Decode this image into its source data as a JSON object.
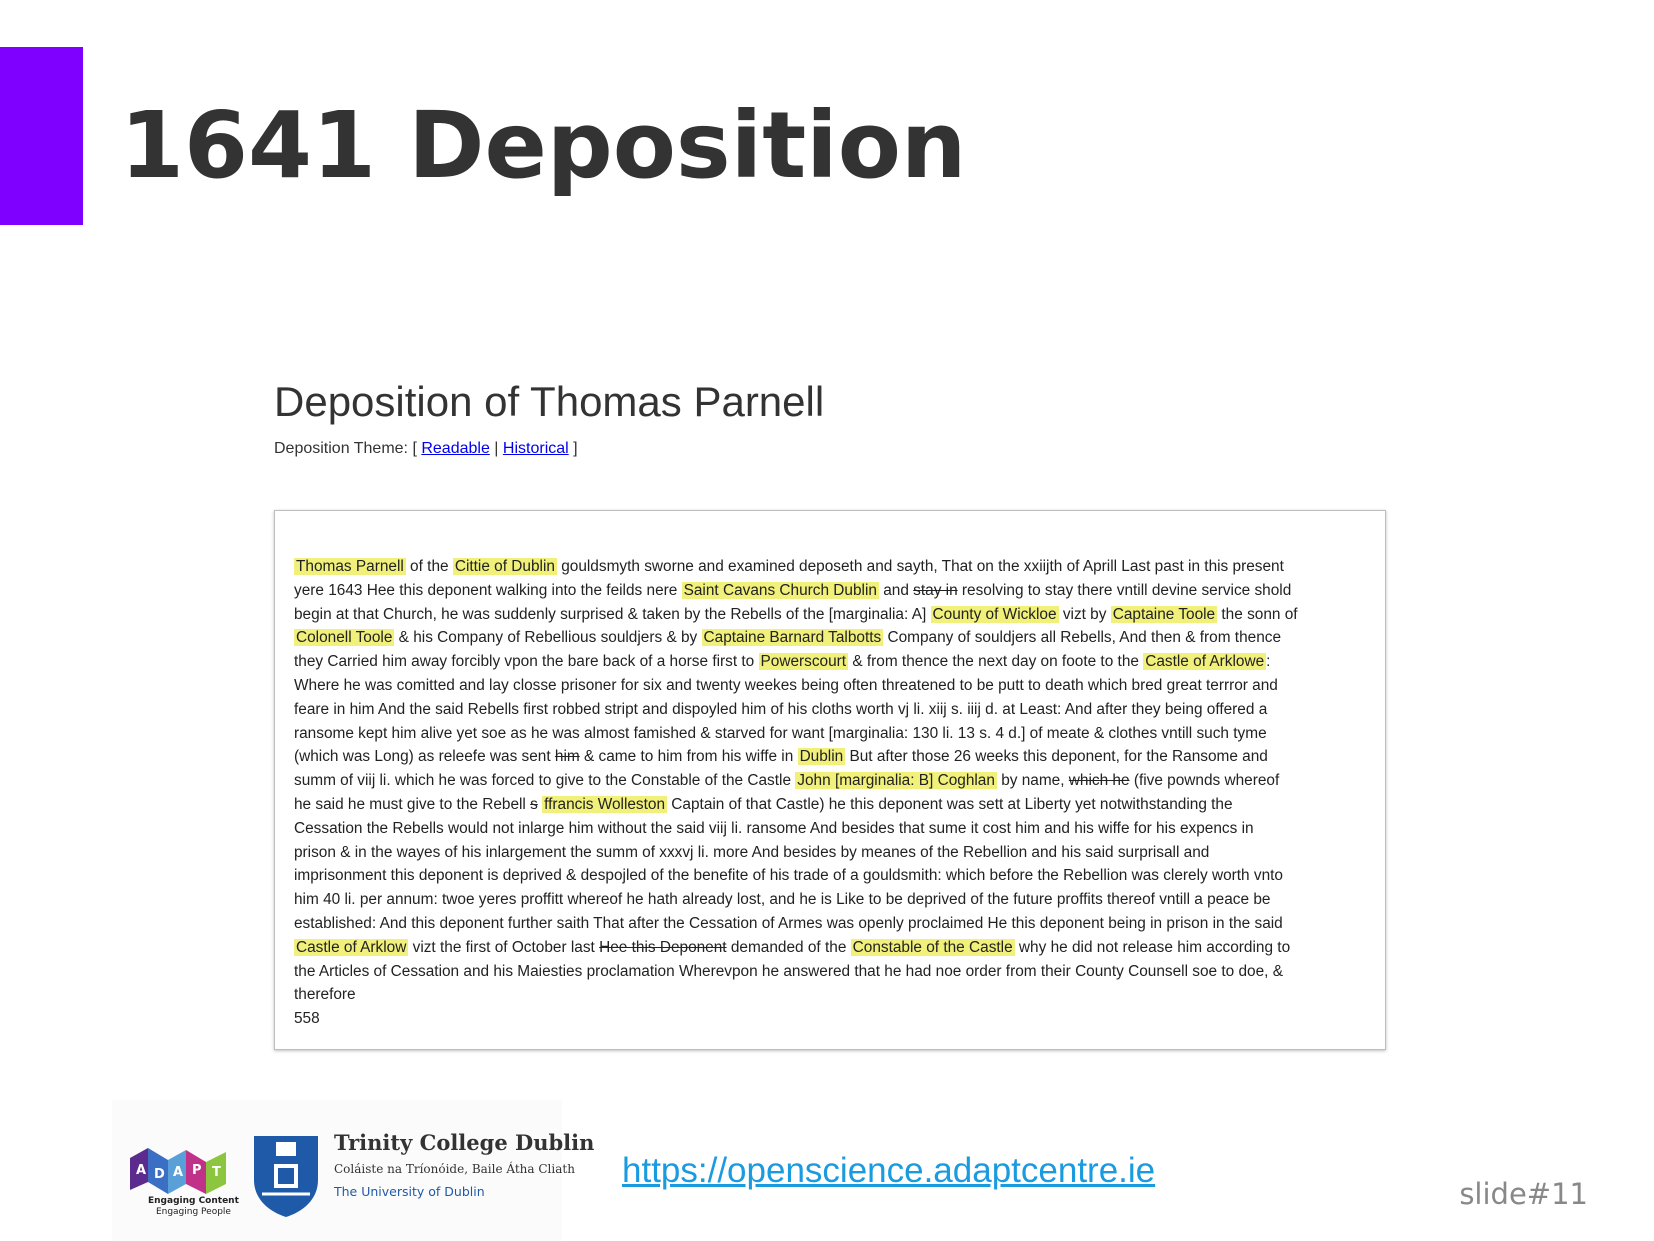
{
  "slide": {
    "title": "1641 Deposition",
    "link": "https://openscience.adaptcentre.ie",
    "slide_number": "slide#11",
    "accent_color": "#8000ff"
  },
  "deposition": {
    "heading": "Deposition of Thomas Parnell",
    "theme_label": "Deposition Theme: [",
    "theme_options": [
      "Readable",
      "Historical"
    ],
    "theme_separator": "|",
    "theme_close": "]",
    "highlight_color": "#f0f07a",
    "lines": [
      [
        {
          "t": "Thomas Parnell",
          "s": "hl"
        },
        {
          "t": " of the "
        },
        {
          "t": "Cittie of Dublin",
          "s": "hl"
        },
        {
          "t": " gouldsmyth sworne and examined deposeth and sayth, That on the xxiijth of Aprill Last past in this present"
        }
      ],
      [
        {
          "t": "yere 1643 Hee this deponent walking into the feilds nere "
        },
        {
          "t": "Saint Cavans Church Dublin",
          "s": "hl"
        },
        {
          "t": " and "
        },
        {
          "t": "stay in",
          "s": "del"
        },
        {
          "t": " resolving to stay there vntill devine service shold"
        }
      ],
      [
        {
          "t": "begin at that Church, he was suddenly surprised & taken by the Rebells of the [marginalia: A] "
        },
        {
          "t": "County of Wickloe",
          "s": "hl"
        },
        {
          "t": " vizt by "
        },
        {
          "t": "Captaine Toole",
          "s": "hl"
        },
        {
          "t": " the sonn of"
        }
      ],
      [
        {
          "t": "Colonell Toole",
          "s": "hl"
        },
        {
          "t": " & his Company of Rebellious souldjers & by "
        },
        {
          "t": "Captaine Barnard Talbotts",
          "s": "hl"
        },
        {
          "t": " Company of souldjers all Rebells, And then & from thence"
        }
      ],
      [
        {
          "t": "they Carried him away forcibly vpon the bare back of a horse first to "
        },
        {
          "t": "Powerscourt",
          "s": "hl"
        },
        {
          "t": " & from thence the next day on foote to the "
        },
        {
          "t": "Castle of Arklowe",
          "s": "hl"
        },
        {
          "t": ":"
        }
      ],
      [
        {
          "t": "Where he was comitted and lay closse prisoner for six and twenty weekes being often threatened to be putt to death which bred great terrror and"
        }
      ],
      [
        {
          "t": "feare in him And the said Rebells first robbed stript and dispoyled him of his cloths worth vj li. xiij s. iiij d. at Least: And after they being offered a"
        }
      ],
      [
        {
          "t": "ransome kept him alive yet soe as he was almost famished & starved for want [marginalia: 130 li. 13 s. 4 d.] of meate & clothes vntill such tyme"
        }
      ],
      [
        {
          "t": "(which was Long) as releefe was sent "
        },
        {
          "t": "him",
          "s": "del"
        },
        {
          "t": " & came to him from his wiffe in "
        },
        {
          "t": "Dublin",
          "s": "hl"
        },
        {
          "t": " But after those 26 weeks this deponent, for the Ransome and"
        }
      ],
      [
        {
          "t": "summ of viij li. which he was forced to give to the Constable of the Castle "
        },
        {
          "t": "John [marginalia: B] Coghlan",
          "s": "hl"
        },
        {
          "t": " by name, "
        },
        {
          "t": "which he",
          "s": "del"
        },
        {
          "t": " (five pownds whereof"
        }
      ],
      [
        {
          "t": "he said he must give to the Rebell "
        },
        {
          "t": "s",
          "s": "del"
        },
        {
          "t": " "
        },
        {
          "t": "ffrancis Wolleston",
          "s": "hl"
        },
        {
          "t": " Captain of that Castle) he this deponent was sett at Liberty yet notwithstanding the"
        }
      ],
      [
        {
          "t": "Cessation the Rebells would not inlarge him without the said viij li. ransome And besides that sume it cost him and his wiffe for his expencs in"
        }
      ],
      [
        {
          "t": "prison & in the wayes of his inlargement the summ of xxxvj li. more And besides by meanes of the Rebellion and his said surprisall and"
        }
      ],
      [
        {
          "t": "imprisonment this deponent is deprived & despojled of the benefite of his trade of a gouldsmith: which before the Rebellion was clerely worth vnto"
        }
      ],
      [
        {
          "t": "him 40 li. per annum: twoe yeres proffitt whereof he hath already lost, and he is Like to be deprived of the future proffits thereof vntill a peace be"
        }
      ],
      [
        {
          "t": "established: And this deponent further saith That after the Cessation of Armes was openly proclaimed He this deponent being in prison in the said"
        }
      ],
      [
        {
          "t": "Castle of Arklow",
          "s": "hl"
        },
        {
          "t": " vizt the first of October last "
        },
        {
          "t": "Hee this Deponent",
          "s": "del"
        },
        {
          "t": " demanded of the "
        },
        {
          "t": "Constable of the Castle",
          "s": "hl"
        },
        {
          "t": " why he did not release him according to"
        }
      ],
      [
        {
          "t": "the Articles of Cessation and his Maiesties proclamation Wherevpon he answered that he had noe order from their County Counsell soe to doe, &"
        }
      ],
      [
        {
          "t": "therefore"
        }
      ],
      [
        {
          "t": "558"
        }
      ]
    ]
  },
  "logos": {
    "adapt_letters": [
      "A",
      "D",
      "A",
      "P",
      "T"
    ],
    "adapt_tagline_1": "Engaging Content",
    "adapt_tagline_2": "Engaging People",
    "tcd_name": "Trinity College Dublin",
    "tcd_irish": "Coláiste na Tríonóide, Baile Átha Cliath",
    "tcd_sub": "The University of Dublin"
  }
}
